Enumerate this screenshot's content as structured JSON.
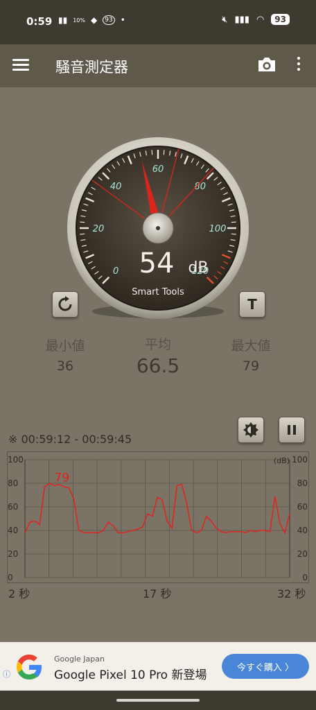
{
  "status_bar": {
    "time": "0:59",
    "net_speed": "10%",
    "battery_circle": "93",
    "battery": "93",
    "dot": "•"
  },
  "app_bar": {
    "title": "騒音測定器"
  },
  "gauge": {
    "reading": "54",
    "unit": "dB",
    "brand": "Smart Tools",
    "scale_labels": [
      "0",
      "20",
      "40",
      "60",
      "80",
      "100",
      "120"
    ],
    "scale_min": 0,
    "scale_max": 120,
    "needle_value": 54,
    "min_marker": 36,
    "max_marker": 79,
    "avg_marker": 66.5
  },
  "buttons": {
    "reset_icon": "refresh-icon",
    "t_label": "T"
  },
  "stats": {
    "min_label": "最小値",
    "min_value": "36",
    "avg_label": "平均",
    "avg_value": "66.5",
    "max_label": "最大値",
    "max_value": "79"
  },
  "graph": {
    "time_range": "※ 00:59:12 - 00:59:45",
    "peak_label": "79",
    "unit_label": "(dB)",
    "y_ticks": [
      "100",
      "80",
      "60",
      "40",
      "20",
      "0"
    ],
    "x_labels": [
      "2 秒",
      "17 秒",
      "32 秒"
    ],
    "line_color": "#e0241b",
    "samples": [
      38,
      47,
      48,
      45,
      77,
      80,
      78,
      79,
      77,
      76,
      66,
      40,
      38,
      38,
      38,
      38,
      40,
      47,
      44,
      38,
      38,
      39,
      40,
      41,
      43,
      54,
      52,
      68,
      66,
      48,
      42,
      78,
      79,
      63,
      40,
      38,
      40,
      52,
      48,
      42,
      39,
      38,
      39,
      39,
      39,
      38,
      40,
      39,
      40,
      40,
      39,
      69,
      46,
      38,
      54
    ]
  },
  "ad": {
    "source": "Google Japan",
    "title": "Google Pixel 10 Pro 新登場",
    "cta": "今すぐ購入 〉",
    "info": "ⓘ"
  }
}
